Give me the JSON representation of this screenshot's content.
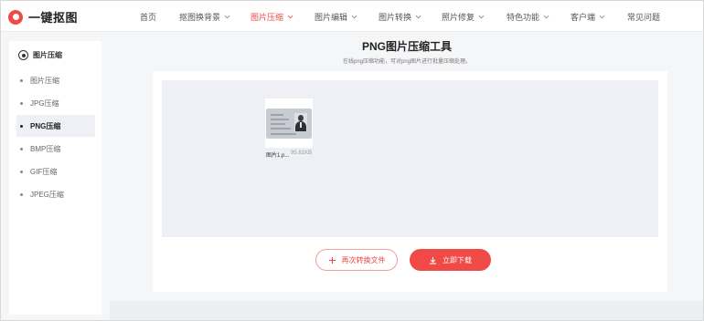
{
  "brand": {
    "name": "一键抠图",
    "accent": "#ef4a45"
  },
  "nav": [
    {
      "label": "首页",
      "dropdown": false,
      "active": false
    },
    {
      "label": "抠图换背景",
      "dropdown": true,
      "active": false
    },
    {
      "label": "图片压缩",
      "dropdown": true,
      "active": true
    },
    {
      "label": "图片编辑",
      "dropdown": true,
      "active": false
    },
    {
      "label": "图片转换",
      "dropdown": true,
      "active": false
    },
    {
      "label": "照片修复",
      "dropdown": true,
      "active": false
    },
    {
      "label": "特色功能",
      "dropdown": true,
      "active": false
    },
    {
      "label": "客户端",
      "dropdown": true,
      "active": false
    },
    {
      "label": "常见问题",
      "dropdown": false,
      "active": false
    }
  ],
  "sidebar": {
    "heading": "图片压缩",
    "items": [
      {
        "label": "图片压缩",
        "active": false
      },
      {
        "label": "JPG压缩",
        "active": false
      },
      {
        "label": "PNG压缩",
        "active": true
      },
      {
        "label": "BMP压缩",
        "active": false
      },
      {
        "label": "GIF压缩",
        "active": false
      },
      {
        "label": "JPEG压缩",
        "active": false
      }
    ]
  },
  "main": {
    "title": "PNG图片压缩工具",
    "subtitle": "在线png压缩功能，可对png图片进行批量压缩处理。",
    "file": {
      "name": "图片1.p...",
      "size": "95.81KB"
    },
    "convert_again_label": "再次转换文件",
    "download_label": "立即下载"
  }
}
